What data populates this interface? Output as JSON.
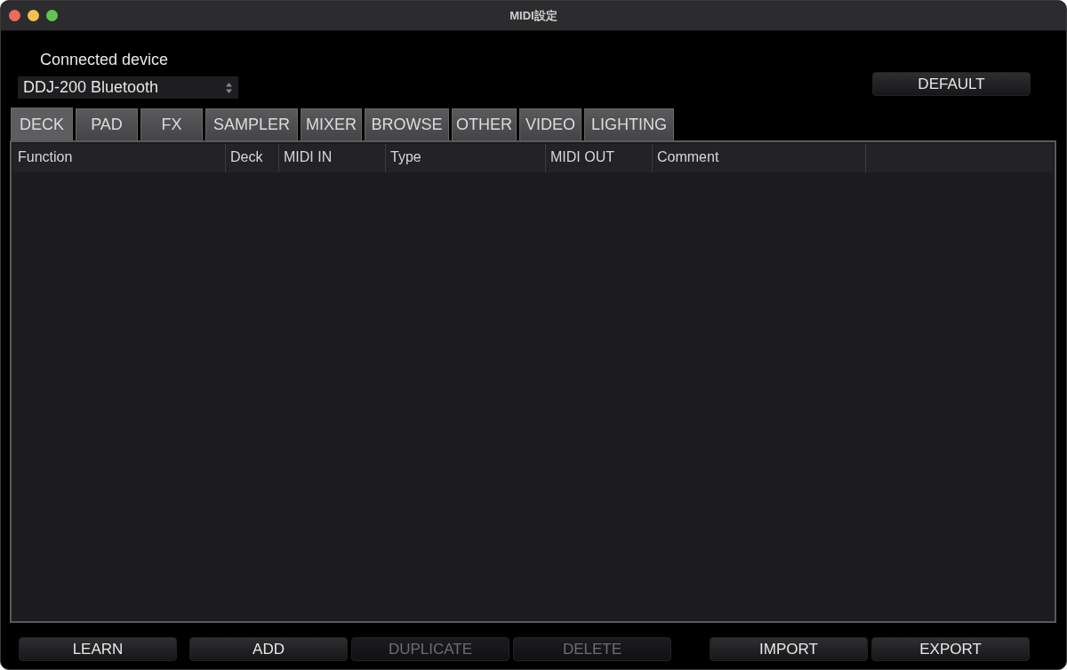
{
  "window": {
    "title": "MIDI設定"
  },
  "device": {
    "label": "Connected device",
    "value": "DDJ-200 Bluetooth"
  },
  "default_button": {
    "label": "DEFAULT",
    "disabled": false
  },
  "tabs": [
    {
      "label": "DECK",
      "selected": true
    },
    {
      "label": "PAD",
      "selected": false
    },
    {
      "label": "FX",
      "selected": false
    },
    {
      "label": "SAMPLER",
      "selected": false
    },
    {
      "label": "MIXER",
      "selected": false
    },
    {
      "label": "BROWSE",
      "selected": false
    },
    {
      "label": "OTHER",
      "selected": false
    },
    {
      "label": "VIDEO",
      "selected": false
    },
    {
      "label": "LIGHTING",
      "selected": false
    }
  ],
  "table": {
    "columns": [
      "Function",
      "Deck",
      "MIDI IN",
      "Type",
      "MIDI OUT",
      "Comment"
    ]
  },
  "buttons": [
    {
      "label": "LEARN",
      "disabled": false
    },
    {
      "label": "ADD",
      "disabled": false
    },
    {
      "label": "DUPLICATE",
      "disabled": true
    },
    {
      "label": "DELETE",
      "disabled": true
    },
    {
      "label": "IMPORT",
      "disabled": false
    },
    {
      "label": "EXPORT",
      "disabled": false
    }
  ]
}
